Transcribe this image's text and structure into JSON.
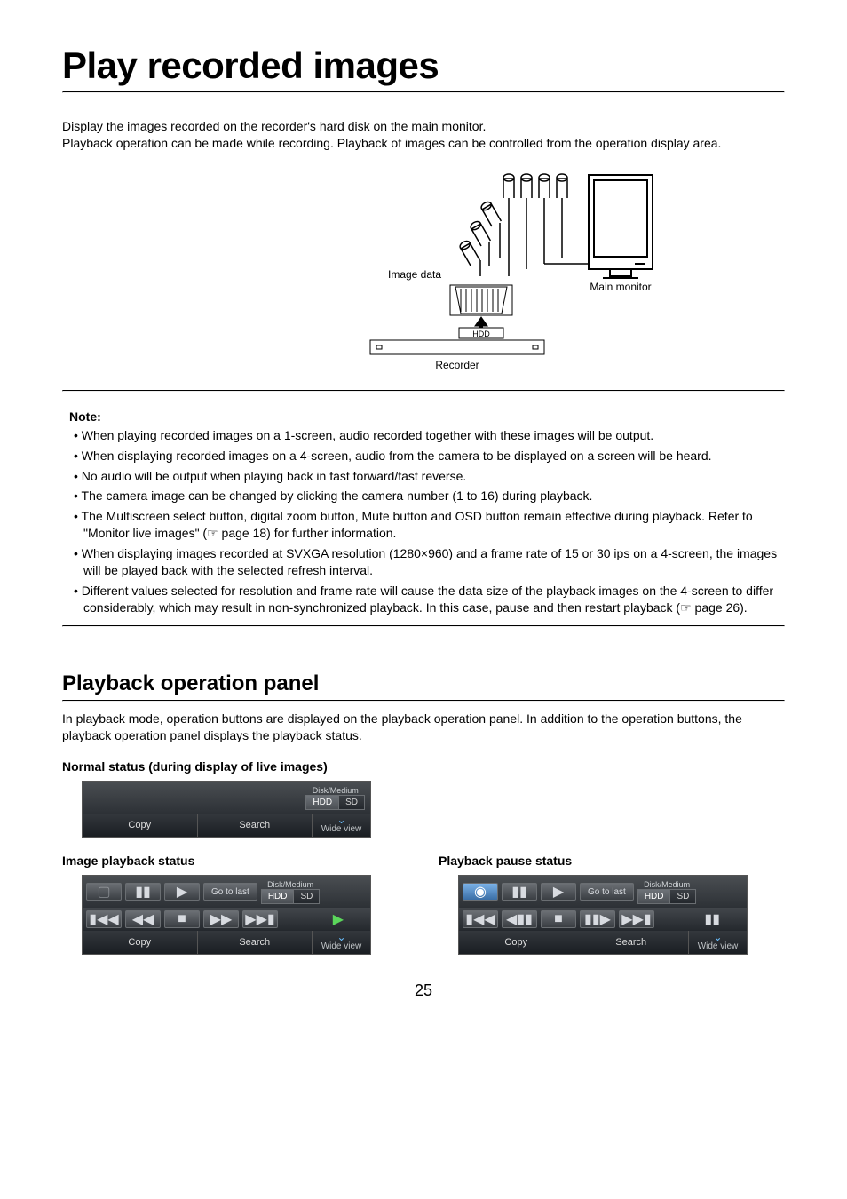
{
  "title": "Play recorded images",
  "intro": "Display the images recorded on the recorder's hard disk on the main monitor.\nPlayback operation can be made while recording. Playback of images can be controlled from the operation display area.",
  "diagram": {
    "image_data": "Image data",
    "main_monitor": "Main monitor",
    "hdd": "HDD",
    "recorder": "Recorder"
  },
  "note": {
    "heading": "Note:",
    "items": [
      "When playing recorded images on a 1-screen, audio recorded together with these images will be output.",
      "When displaying recorded images on a 4-screen, audio from the camera to be displayed on a screen will be heard.",
      "No audio will be output when playing back in fast forward/fast reverse.",
      "The camera image can be changed by clicking the camera number (1 to 16) during playback.",
      "The Multiscreen select button, digital zoom button, Mute button and OSD button remain effective during playback. Refer to \"Monitor live images\" (☞ page 18) for further information.",
      "When displaying images recorded at SVXGA resolution (1280×960) and a frame rate of 15 or 30 ips on a 4-screen, the images will be played back with the selected refresh interval.",
      "Different values selected for resolution and frame rate will cause the data size of the playback images on the 4-screen to differ considerably, which may result in non-synchronized playback. In this case, pause and then restart playback (☞ page 26)."
    ]
  },
  "section": {
    "heading": "Playback operation panel",
    "para": "In playback mode, operation buttons are displayed on the playback operation panel. In addition to the operation buttons, the playback operation panel displays the playback status."
  },
  "panels": {
    "disk_medium": "Disk/Medium",
    "hdd": "HDD",
    "sd": "SD",
    "copy": "Copy",
    "search": "Search",
    "wide_view": "Wide view",
    "go_to_last": "Go to last",
    "normal_heading": "Normal status (during display of live images)",
    "playback_heading": "Image playback status",
    "pause_heading": "Playback pause status"
  },
  "page_number": "25"
}
